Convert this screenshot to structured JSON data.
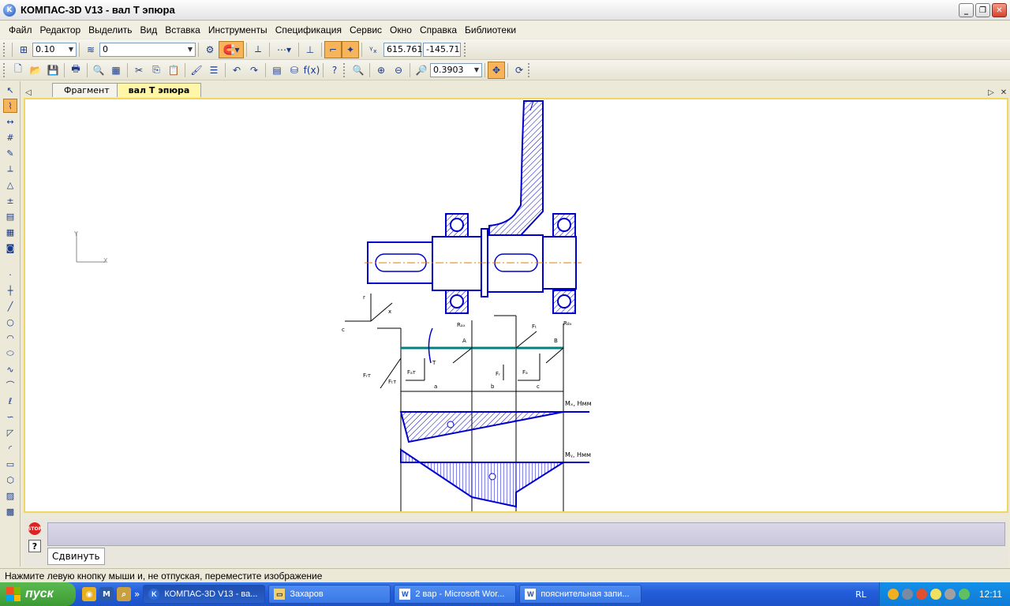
{
  "window": {
    "title": "КОМПАС-3D V13 - вал T эпюра",
    "icon": "kompas-icon"
  },
  "menu": [
    "Файл",
    "Редактор",
    "Выделить",
    "Вид",
    "Вставка",
    "Инструменты",
    "Спецификация",
    "Сервис",
    "Окно",
    "Справка",
    "Библиотеки"
  ],
  "toolbar1": {
    "step": "0.10",
    "layer": "0",
    "coord_x": "615.761",
    "coord_y": "-145.71"
  },
  "toolbar2": {
    "zoom": "0.3903",
    "fx_label": "f(x)"
  },
  "tabs": [
    {
      "label": "Фрагмент",
      "active": false
    },
    {
      "label": "вал T эпюра",
      "active": true
    }
  ],
  "drawing": {
    "axis_y": "Y",
    "axis_x": "X",
    "labels": {
      "r": "r",
      "x": "x",
      "c": "c",
      "Fr": "Fᵣ",
      "Fa": "Fₐ",
      "Ft": "Fₜ",
      "RAx": "Rₐₓ",
      "RBx": "R₈ₓ",
      "A": "A",
      "B": "B",
      "FrT": "Fᵣт",
      "FtT": "Fₜт",
      "FaT": "Fₐт",
      "T": "T",
      "a": "a",
      "b": "b",
      "cdim": "c",
      "Mx": "Mₓ, Нмм",
      "My": "Mᵧ, Нмм"
    }
  },
  "command_tab": "Сдвинуть",
  "status": "Нажмите левую кнопку мыши и, не отпуская, переместите изображение",
  "taskbar": {
    "start": "пуск",
    "tasks": [
      {
        "label": "КОМПАС-3D V13 - ва...",
        "icon": "kompas-icon",
        "active": true
      },
      {
        "label": "Захаров",
        "icon": "folder-icon",
        "active": false
      },
      {
        "label": "2 вар - Microsoft Wor...",
        "icon": "word-icon",
        "active": false
      },
      {
        "label": "пояснительная запи...",
        "icon": "word-icon",
        "active": false
      }
    ],
    "lang": "RL",
    "clock": "12:11"
  },
  "colors": {
    "accent": "#f8b45a",
    "drawing": "#0000cc",
    "axis": "#e08000",
    "baseline": "#008080"
  }
}
